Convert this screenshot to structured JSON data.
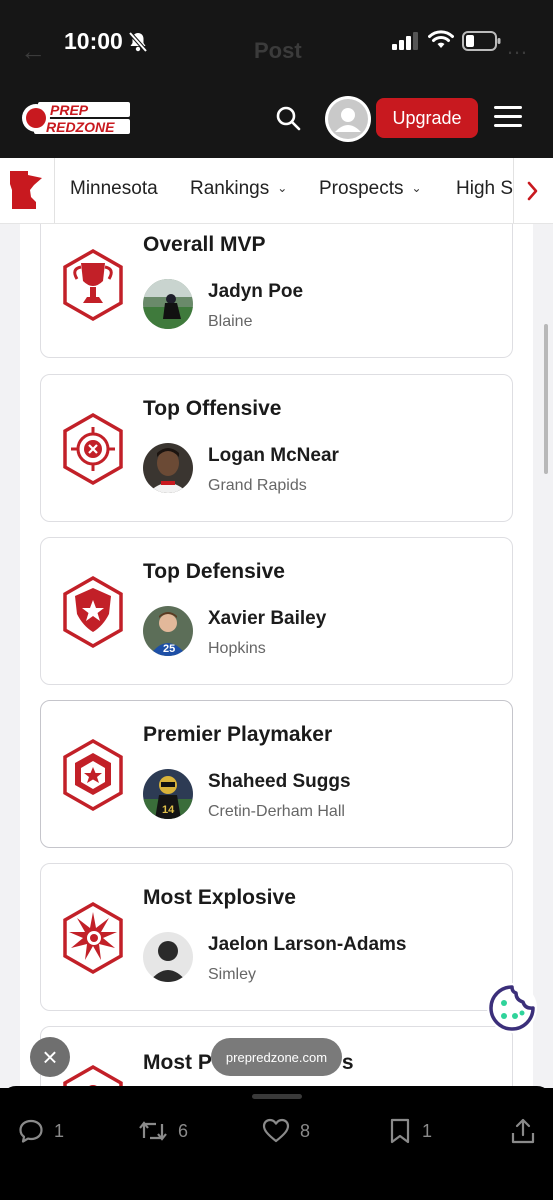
{
  "status_bar": {
    "time": "10:00"
  },
  "ghost_header": {
    "title": "Post"
  },
  "header": {
    "logo_top": "PREP",
    "logo_bottom": "REDZONE",
    "upgrade_label": "Upgrade"
  },
  "subnav": {
    "items": [
      {
        "label": "Minnesota"
      },
      {
        "label": "Rankings",
        "chevron": "⌄"
      },
      {
        "label": "Prospects",
        "chevron": "⌄"
      },
      {
        "label": "High S"
      }
    ],
    "next_icon": "›"
  },
  "awards": [
    {
      "title": "Overall MVP",
      "name": "Jadyn Poe",
      "school": "Blaine"
    },
    {
      "title": "Top Offensive",
      "name": "Logan McNear",
      "school": "Grand Rapids"
    },
    {
      "title": "Top Defensive",
      "name": "Xavier Bailey",
      "school": "Hopkins"
    },
    {
      "title": "Premier Playmaker",
      "name": "Shaheed Suggs",
      "school": "Cretin-Derham Hall"
    },
    {
      "title": "Most Explosive",
      "name": "Jaelon Larson-Adams",
      "school": "Simley"
    },
    {
      "title": "Most P",
      "title_tail": "s"
    }
  ],
  "overlay": {
    "close_icon": "×",
    "domain": "prepredzone.com"
  },
  "actions": {
    "replies": "1",
    "reposts": "6",
    "likes": "8",
    "bookmarks": "1"
  },
  "colors": {
    "brand_red": "#c8191f",
    "icon_red": "#c22028",
    "cookie_purple": "#3b2f7a",
    "cookie_mint": "#2fd39a"
  }
}
